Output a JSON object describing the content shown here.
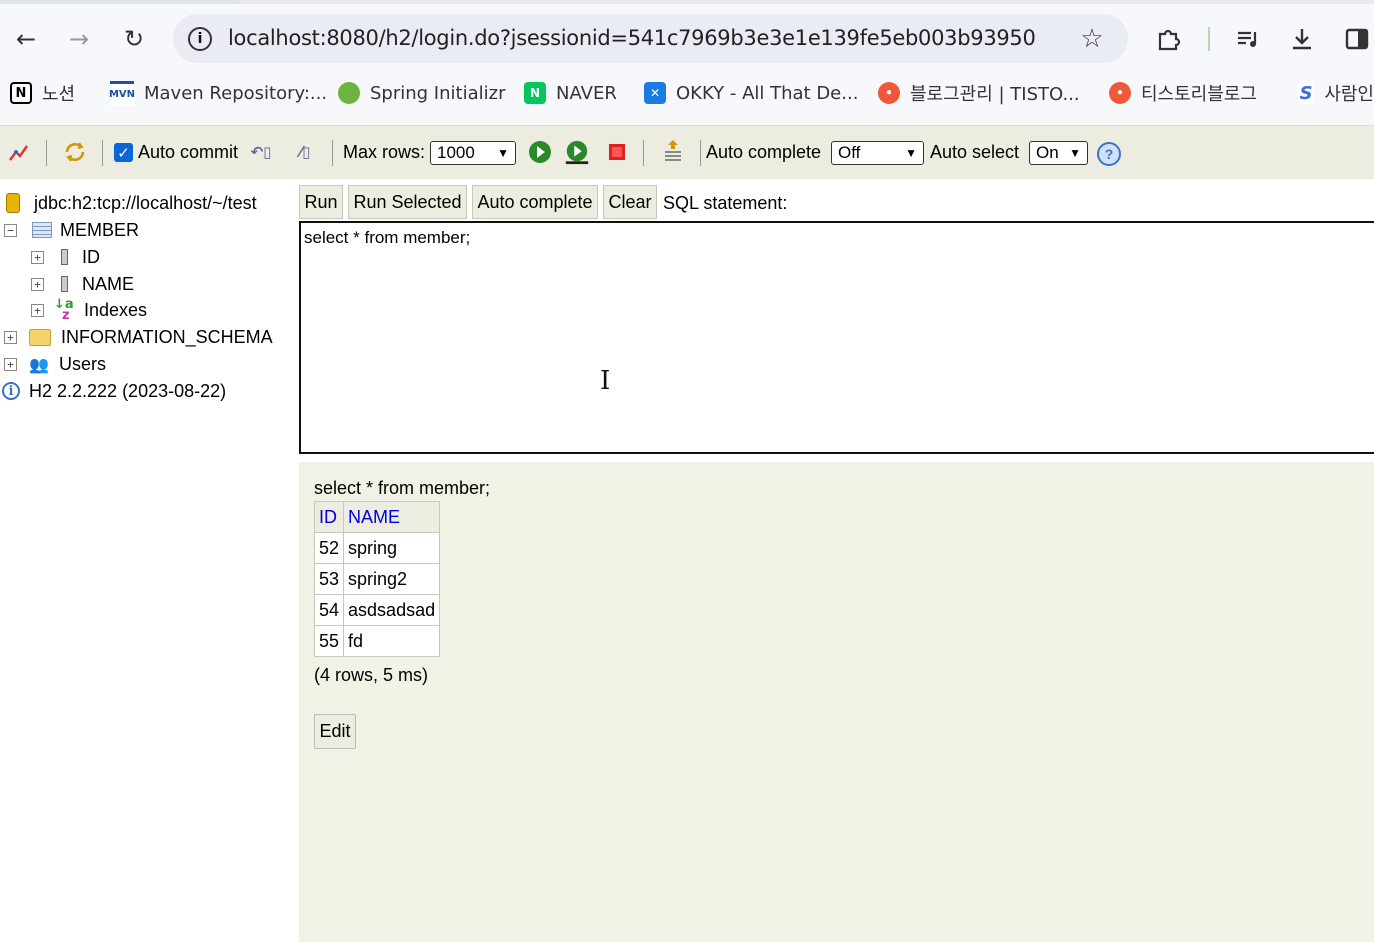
{
  "browser": {
    "url": "localhost:8080/h2/login.do?jsessionid=541c7969b3e3e1e139fe5eb003b93950",
    "bookmarks": [
      {
        "label": "노션",
        "icon": "notion-icon"
      },
      {
        "label": "Maven Repository:...",
        "icon": "maven-icon"
      },
      {
        "label": "Spring Initializr",
        "icon": "spring-icon"
      },
      {
        "label": "NAVER",
        "icon": "naver-icon"
      },
      {
        "label": "OKKY - All That De...",
        "icon": "okky-icon"
      },
      {
        "label": "블로그관리 | TISTO...",
        "icon": "tistory-icon"
      },
      {
        "label": "티스토리블로그",
        "icon": "tistory-icon"
      },
      {
        "label": "사람인",
        "icon": "saramin-icon"
      }
    ]
  },
  "toolbar": {
    "auto_commit_label": "Auto commit",
    "auto_commit_checked": true,
    "max_rows_label": "Max rows:",
    "max_rows_value": "1000",
    "auto_complete_label": "Auto complete",
    "auto_complete_value": "Off",
    "auto_select_label": "Auto select",
    "auto_select_value": "On",
    "help_label": "?"
  },
  "tree": {
    "connection": "jdbc:h2:tcp://localhost/~/test",
    "table": "MEMBER",
    "columns": [
      "ID",
      "NAME"
    ],
    "indexes": "Indexes",
    "schema": "INFORMATION_SCHEMA",
    "users": "Users",
    "version": "H2 2.2.222 (2023-08-22)"
  },
  "query": {
    "buttons": {
      "run": "Run",
      "run_selected": "Run Selected",
      "auto_complete": "Auto complete",
      "clear": "Clear"
    },
    "sql_label": "SQL statement:",
    "sql_text": "select * from member;"
  },
  "result": {
    "statement": "select * from member;",
    "headers": [
      "ID",
      "NAME"
    ],
    "rows": [
      [
        "52",
        "spring"
      ],
      [
        "53",
        "spring2"
      ],
      [
        "54",
        "asdsadsad"
      ],
      [
        "55",
        "fd"
      ]
    ],
    "summary": "(4 rows, 5 ms)",
    "edit_label": "Edit"
  }
}
